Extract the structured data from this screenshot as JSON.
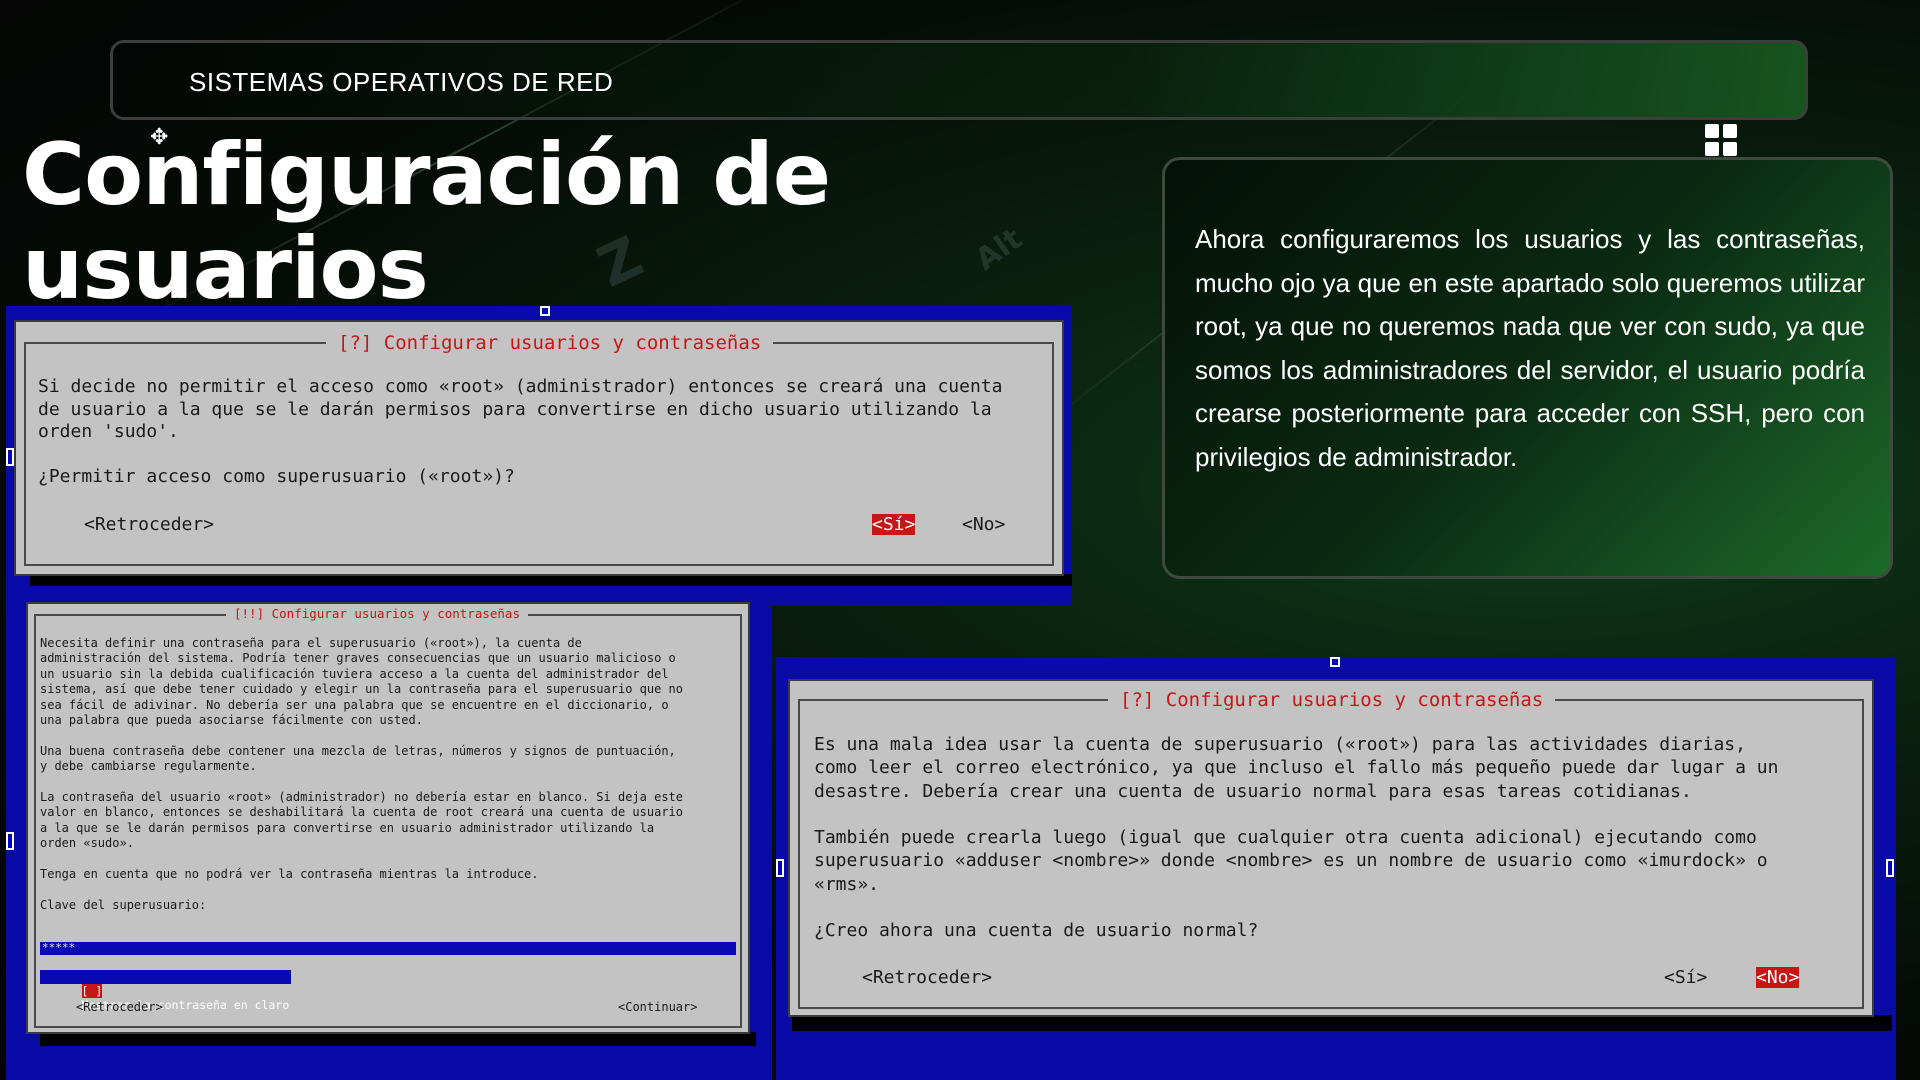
{
  "header": {
    "section_label": "SISTEMAS OPERATIVOS DE RED"
  },
  "page": {
    "title": "Configuración de usuarios"
  },
  "info": {
    "text": "Ahora configuraremos los usuarios y las contraseñas, mucho ojo ya que en este apartado solo queremos utilizar root, ya que no queremos nada que ver con sudo, ya que somos los administradores del servidor, el usuario podría crearse posteriormente para acceder con SSH, pero con privilegios de administrador."
  },
  "dialog_root_access": {
    "title": "[?] Configurar usuarios y contraseñas",
    "body": "Si decide no permitir el acceso como «root» (administrador) entonces se creará una cuenta\nde usuario a la que se le darán permisos para convertirse en dicho usuario utilizando la\norden 'sudo'.\n\n¿Permitir acceso como superusuario («root»)?",
    "buttons": {
      "back": "<Retroceder>",
      "yes": "<Sí>",
      "no": "<No>"
    },
    "selected": "yes"
  },
  "dialog_root_password": {
    "title": "[!!] Configurar usuarios y contraseñas",
    "body": "Necesita definir una contraseña para el superusuario («root»), la cuenta de\nadministración del sistema. Podría tener graves consecuencias que un usuario malicioso o\nun usuario sin la debida cualificación tuviera acceso a la cuenta del administrador del\nsistema, así que debe tener cuidado y elegir un la contraseña para el superusuario que no\nsea fácil de adivinar. No debería ser una palabra que se encuentre en el diccionario, o\nuna palabra que pueda asociarse fácilmente con usted.\n\nUna buena contraseña debe contener una mezcla de letras, números y signos de puntuación,\ny debe cambiarse regularmente.\n\nLa contraseña del usuario «root» (administrador) no debería estar en blanco. Si deja este\nvalor en blanco, entonces se deshabilitará la cuenta de root creará una cuenta de usuario\na la que se le darán permisos para convertirse en usuario administrador utilizando la\norden «sudo».\n\nTenga en cuenta que no podrá ver la contraseña mientras la introduce.\n\nClave del superusuario:",
    "password_value": "*****",
    "checkbox_label": "Mostrar la contraseña en claro",
    "checkbox_mark": "[ ]",
    "buttons": {
      "back": "<Retroceder>",
      "continue": "<Continuar>"
    }
  },
  "dialog_normal_user": {
    "title": "[?] Configurar usuarios y contraseñas",
    "body": "Es una mala idea usar la cuenta de superusuario («root») para las actividades diarias,\ncomo leer el correo electrónico, ya que incluso el fallo más pequeño puede dar lugar a un\ndesastre. Debería crear una cuenta de usuario normal para esas tareas cotidianas.\n\nTambién puede crearla luego (igual que cualquier otra cuenta adicional) ejecutando como\nsuperusuario «adduser <nombre>» donde <nombre> es un nombre de usuario como «imurdock» o\n«rms».\n\n¿Creo ahora una cuenta de usuario normal?",
    "buttons": {
      "back": "<Retroceder>",
      "yes": "<Sí>",
      "no": "<No>"
    },
    "selected": "no"
  }
}
